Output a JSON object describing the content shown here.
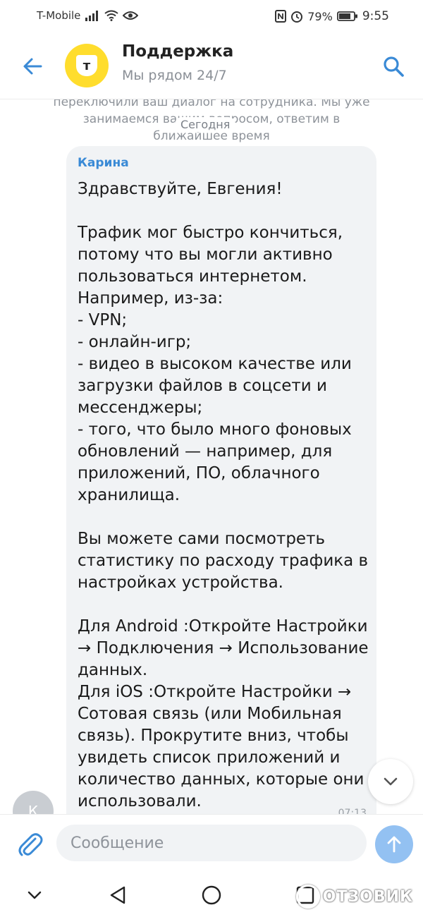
{
  "status_bar": {
    "carrier": "T-Mobile",
    "battery": "79%",
    "time": "9:55"
  },
  "header": {
    "avatar_letter": "т",
    "title": "Поддержка",
    "subtitle": "Мы рядом 24/7"
  },
  "chat": {
    "faded_text": "переключили ваш диалог на сотрудника. Мы уже занимаемся вашим вопросом, ответим в ближайшее время",
    "date_divider": "Сегодня",
    "message": {
      "sender": "Карина",
      "text": "Здравствуйте, Евгения!\n\nТрафик мог быстро кончиться, потому что вы могли активно пользоваться интернетом. Например, из-за:\n- VPN;\n- онлайн-игр;\n- видео в высоком качестве или загрузки файлов в соцсети и мессенджеры;\n- того, что было много фоновых обновлений — например, для приложений, ПО, облачного хранилища.\n\nВы можете сами посмотреть статистику по расходу трафика в настройках устройства.\n\nДля Android :Откройте Настройки → Подключения → Использование данных.\nДля iOS :Откройте Настройки → Сотовая связь (или Мобильная связь). Прокрутите вниз, чтобы увидеть список приложений и количество данных, которые они использовали.",
      "time": "07:13"
    },
    "agent_avatar_letter": "К"
  },
  "input": {
    "placeholder": "Сообщение"
  },
  "watermark": "ОТЗОВИК",
  "colors": {
    "accent": "#3a8ad6",
    "brand_yellow": "#ffdd2d",
    "bubble": "#f1f3f5",
    "send_button": "#93c1f2"
  }
}
